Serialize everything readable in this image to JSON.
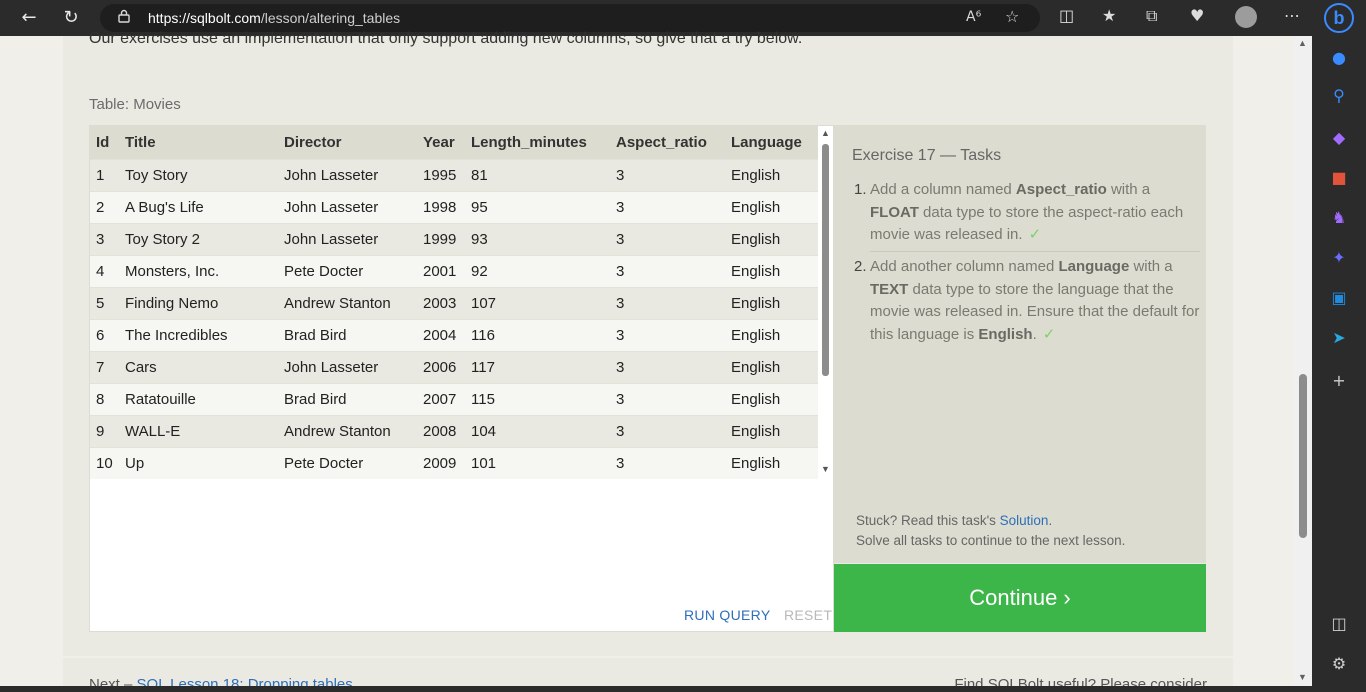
{
  "browser": {
    "url_domain": "https://sqlbolt.com",
    "url_path": "/lesson/altering_tables",
    "icons": [
      "back-icon",
      "refresh-icon",
      "lock-icon",
      "read-aloud-icon",
      "favorite-icon",
      "split-screen-icon",
      "favorites-icon",
      "collections-icon",
      "performance-icon",
      "profile-icon",
      "more-icon",
      "bing-icon"
    ]
  },
  "sidebar": {
    "icons": [
      "bell-icon",
      "search-icon",
      "tag-icon",
      "toolbox-icon",
      "chess-icon",
      "copilot-icon",
      "outlook-icon",
      "telegram-icon",
      "add-icon",
      "panel-icon",
      "settings-icon"
    ]
  },
  "page": {
    "top_text": "Our exercises use an implementation that only support adding new columns, so give that a try below.",
    "table_label": "Table: Movies",
    "table": {
      "columns": [
        "Id",
        "Title",
        "Director",
        "Year",
        "Length_minutes",
        "Aspect_ratio",
        "Language"
      ],
      "rows": [
        [
          "1",
          "Toy Story",
          "John Lasseter",
          "1995",
          "81",
          "3",
          "English"
        ],
        [
          "2",
          "A Bug's Life",
          "John Lasseter",
          "1998",
          "95",
          "3",
          "English"
        ],
        [
          "3",
          "Toy Story 2",
          "John Lasseter",
          "1999",
          "93",
          "3",
          "English"
        ],
        [
          "4",
          "Monsters, Inc.",
          "Pete Docter",
          "2001",
          "92",
          "3",
          "English"
        ],
        [
          "5",
          "Finding Nemo",
          "Andrew Stanton",
          "2003",
          "107",
          "3",
          "English"
        ],
        [
          "6",
          "The Incredibles",
          "Brad Bird",
          "2004",
          "116",
          "3",
          "English"
        ],
        [
          "7",
          "Cars",
          "John Lasseter",
          "2006",
          "117",
          "3",
          "English"
        ],
        [
          "8",
          "Ratatouille",
          "Brad Bird",
          "2007",
          "115",
          "3",
          "English"
        ],
        [
          "9",
          "WALL-E",
          "Andrew Stanton",
          "2008",
          "104",
          "3",
          "English"
        ],
        [
          "10",
          "Up",
          "Pete Docter",
          "2009",
          "101",
          "3",
          "English"
        ]
      ]
    },
    "run_query": "RUN QUERY",
    "reset": "RESET",
    "exercise": {
      "title": "Exercise 17 — Tasks",
      "task1": {
        "num": "1.",
        "pre": "Add a column named ",
        "b1": "Aspect_ratio",
        "mid": " with a ",
        "b2": "FLOAT",
        "post": " data type to store the aspect-ratio each movie was released in.",
        "check": "✓"
      },
      "task2": {
        "num": "2.",
        "pre": "Add another column named ",
        "b1": "Language",
        "mid": " with a ",
        "b2": "TEXT",
        "mid2": " data type to store the language that the movie was released in. Ensure that the default for this language is ",
        "b3": "English",
        "post": ".",
        "check": "✓"
      },
      "stuck_pre": "Stuck? Read this task's ",
      "solution_link": "Solution",
      "stuck_post": ".",
      "solve_all": "Solve all tasks to continue to the next lesson.",
      "continue": "Continue ›"
    },
    "footer": {
      "next_pre": "Next – ",
      "next_link": "SQL Lesson 18: Dropping tables",
      "find": "Find SQLBolt useful? Please consider"
    }
  },
  "colors": {
    "accent_green": "#3cb549",
    "link_blue": "#2d6fb9",
    "check_green": "#7fcf6a"
  }
}
